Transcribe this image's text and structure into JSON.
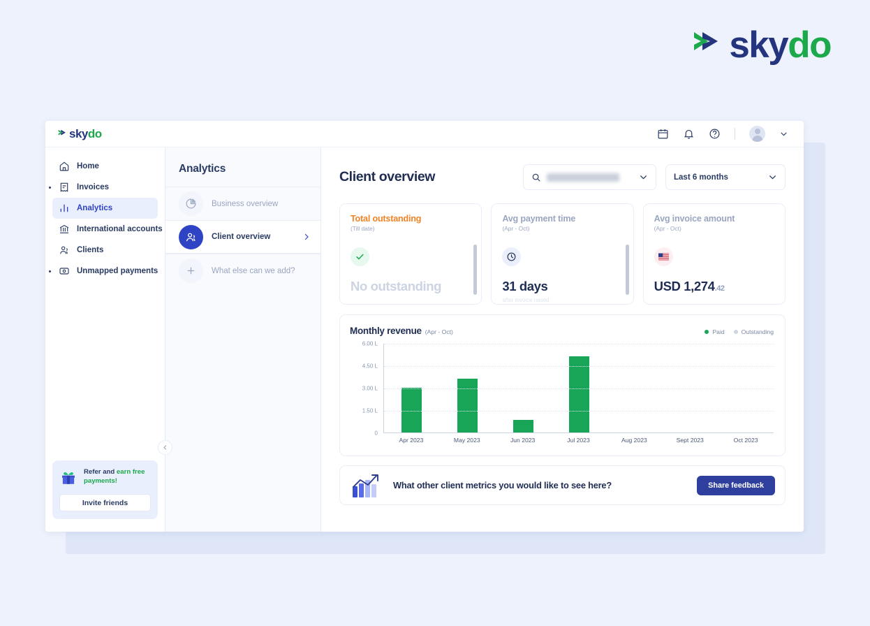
{
  "brand": {
    "name_part1": "sky",
    "name_part2": "do",
    "mark": "skydo-chevron-logo",
    "color_blue": "#24357e",
    "color_green": "#1ba94c"
  },
  "topbar": {
    "icons": [
      {
        "name": "calendar-icon",
        "label": "Calendar"
      },
      {
        "name": "bell-icon",
        "label": "Notifications"
      },
      {
        "name": "help-icon",
        "label": "Help"
      }
    ],
    "avatar_label": "User avatar",
    "caret_label": "Account menu"
  },
  "sidebar": {
    "items": [
      {
        "label": "Home",
        "icon": "home-icon",
        "active": false,
        "bullet": false
      },
      {
        "label": "Invoices",
        "icon": "invoice-icon",
        "active": false,
        "bullet": true
      },
      {
        "label": "Analytics",
        "icon": "bar-chart-icon",
        "active": true,
        "bullet": false
      },
      {
        "label": "International accounts",
        "icon": "bank-icon",
        "active": false,
        "bullet": false
      },
      {
        "label": "Clients",
        "icon": "people-icon",
        "active": false,
        "bullet": false
      },
      {
        "label": "Unmapped payments",
        "icon": "payment-icon",
        "active": false,
        "bullet": true
      }
    ],
    "refer": {
      "headline_plain": "Refer and ",
      "headline_accent": "earn free payments!",
      "icon": "gift-icon",
      "button_label": "Invite friends"
    },
    "collapse_label": "Collapse sidebar"
  },
  "subpanel": {
    "title": "Analytics",
    "items": [
      {
        "label": "Business overview",
        "icon": "pie-chart-icon",
        "active": false
      },
      {
        "label": "Client overview",
        "icon": "people-icon",
        "active": true
      },
      {
        "label": "What else can we add?",
        "icon": "plus-icon",
        "active": false
      }
    ]
  },
  "main": {
    "page_title": "Client overview",
    "search": {
      "icon": "search-icon",
      "value": "Smith & Sons LLC",
      "redacted": true,
      "chevron": "chevron-down-icon"
    },
    "range": {
      "value": "Last 6 months",
      "chevron": "chevron-down-icon"
    },
    "cards": [
      {
        "title": "Total outstanding",
        "title_color": "orange",
        "subtitle": "(Till date)",
        "icon": "check-circle-icon",
        "icon_style": "green",
        "value": "No outstanding",
        "value_is_placeholder": true,
        "decimals": "",
        "note": "",
        "has_scrollbar": true
      },
      {
        "title": "Avg payment time",
        "title_color": "muted",
        "subtitle": "(Apr - Oct)",
        "icon": "clock-icon",
        "icon_style": "blue",
        "value": "31 days",
        "value_is_placeholder": false,
        "decimals": "",
        "note": "after invoice raised",
        "has_scrollbar": true
      },
      {
        "title": "Avg invoice amount",
        "title_color": "muted",
        "subtitle": "(Apr - Oct)",
        "icon": "us-flag-icon",
        "icon_style": "flag",
        "value": "USD 1,274",
        "value_is_placeholder": false,
        "decimals": ".42",
        "note": "",
        "has_scrollbar": false
      }
    ],
    "banner": {
      "icon": "growth-chart-icon",
      "text": "What other client metrics you would like to see here?",
      "button_label": "Share feedback"
    }
  },
  "chart_data": {
    "type": "bar",
    "title": "Monthly revenue",
    "subtitle": "(Apr - Oct)",
    "categories": [
      "Apr 2023",
      "May 2023",
      "Jun 2023",
      "Jul 2023",
      "Aug 2023",
      "Sept 2023",
      "Oct 2023"
    ],
    "series": [
      {
        "name": "Paid",
        "color": "#18a558",
        "values": [
          3.0,
          3.6,
          0.85,
          5.1,
          0,
          0,
          0
        ]
      },
      {
        "name": "Outstanding",
        "color": "#c8cfdd",
        "values": [
          0,
          0,
          0,
          0,
          0,
          0,
          0
        ]
      }
    ],
    "ylim": [
      0,
      6
    ],
    "yticks": [
      0,
      1.5,
      3.0,
      4.5,
      6.0
    ],
    "ytick_labels": [
      "0",
      "1.50 L",
      "3.00 L",
      "4.50 L",
      "6.00 L"
    ],
    "xlabel": "",
    "ylabel": "",
    "unit": "L (lakh INR)",
    "grid": true,
    "legend_position": "top-right"
  }
}
